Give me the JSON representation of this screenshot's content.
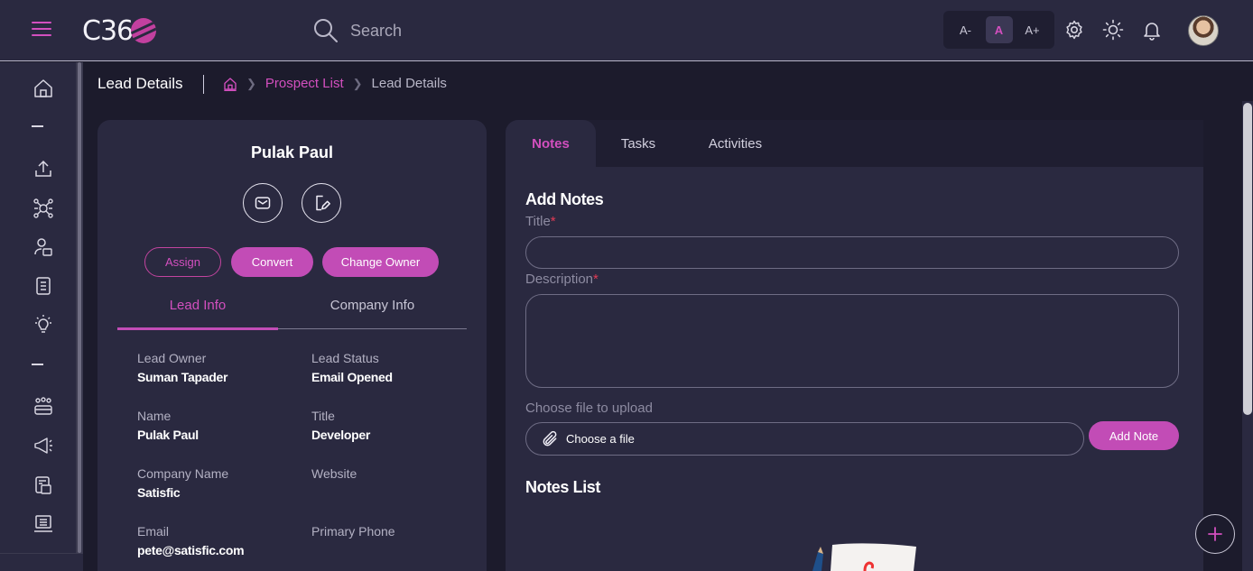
{
  "colors": {
    "accent": "#c24cb6",
    "background": "#1c1b2c",
    "panel": "#2a2940",
    "required": "#e23b55"
  },
  "header": {
    "logo_text": "C36",
    "search_placeholder": "Search",
    "font_size_controls": [
      "A-",
      "A",
      "A+"
    ],
    "font_size_selected": "A",
    "icons": [
      "settings-icon",
      "sun-icon",
      "bell-icon"
    ]
  },
  "sidebar": {
    "icons": [
      "home-icon",
      "upload-icon",
      "network-icon",
      "contacts-icon",
      "document-icon",
      "lightbulb-icon",
      "team-icon",
      "megaphone-icon",
      "report-icon",
      "monitor-icon"
    ]
  },
  "page": {
    "title": "Lead Details",
    "breadcrumb": {
      "link": "Prospect List",
      "current": "Lead Details"
    }
  },
  "lead": {
    "name": "Pulak Paul",
    "actions": {
      "assign": "Assign",
      "convert": "Convert",
      "change_owner": "Change Owner"
    },
    "tabs": {
      "lead_info": "Lead Info",
      "company_info": "Company Info"
    },
    "fields": {
      "lead_owner": {
        "label": "Lead Owner",
        "value": "Suman Tapader"
      },
      "lead_status": {
        "label": "Lead Status",
        "value": "Email Opened"
      },
      "name": {
        "label": "Name",
        "value": "Pulak Paul"
      },
      "title": {
        "label": "Title",
        "value": "Developer"
      },
      "company_name": {
        "label": "Company Name",
        "value": "Satisfic"
      },
      "website": {
        "label": "Website",
        "value": ""
      },
      "email": {
        "label": "Email",
        "value": "pete@satisfic.com"
      },
      "primary_phone": {
        "label": "Primary Phone",
        "value": ""
      }
    }
  },
  "notes_panel": {
    "tabs": [
      "Notes",
      "Tasks",
      "Activities"
    ],
    "active_tab": "Notes",
    "add_notes_heading": "Add Notes",
    "title_label": "Title",
    "description_label": "Description",
    "required_marker": "*",
    "file_label": "Choose file to upload",
    "file_button": "Choose a file",
    "add_note_button": "Add Note",
    "notes_list_heading": "Notes List"
  }
}
